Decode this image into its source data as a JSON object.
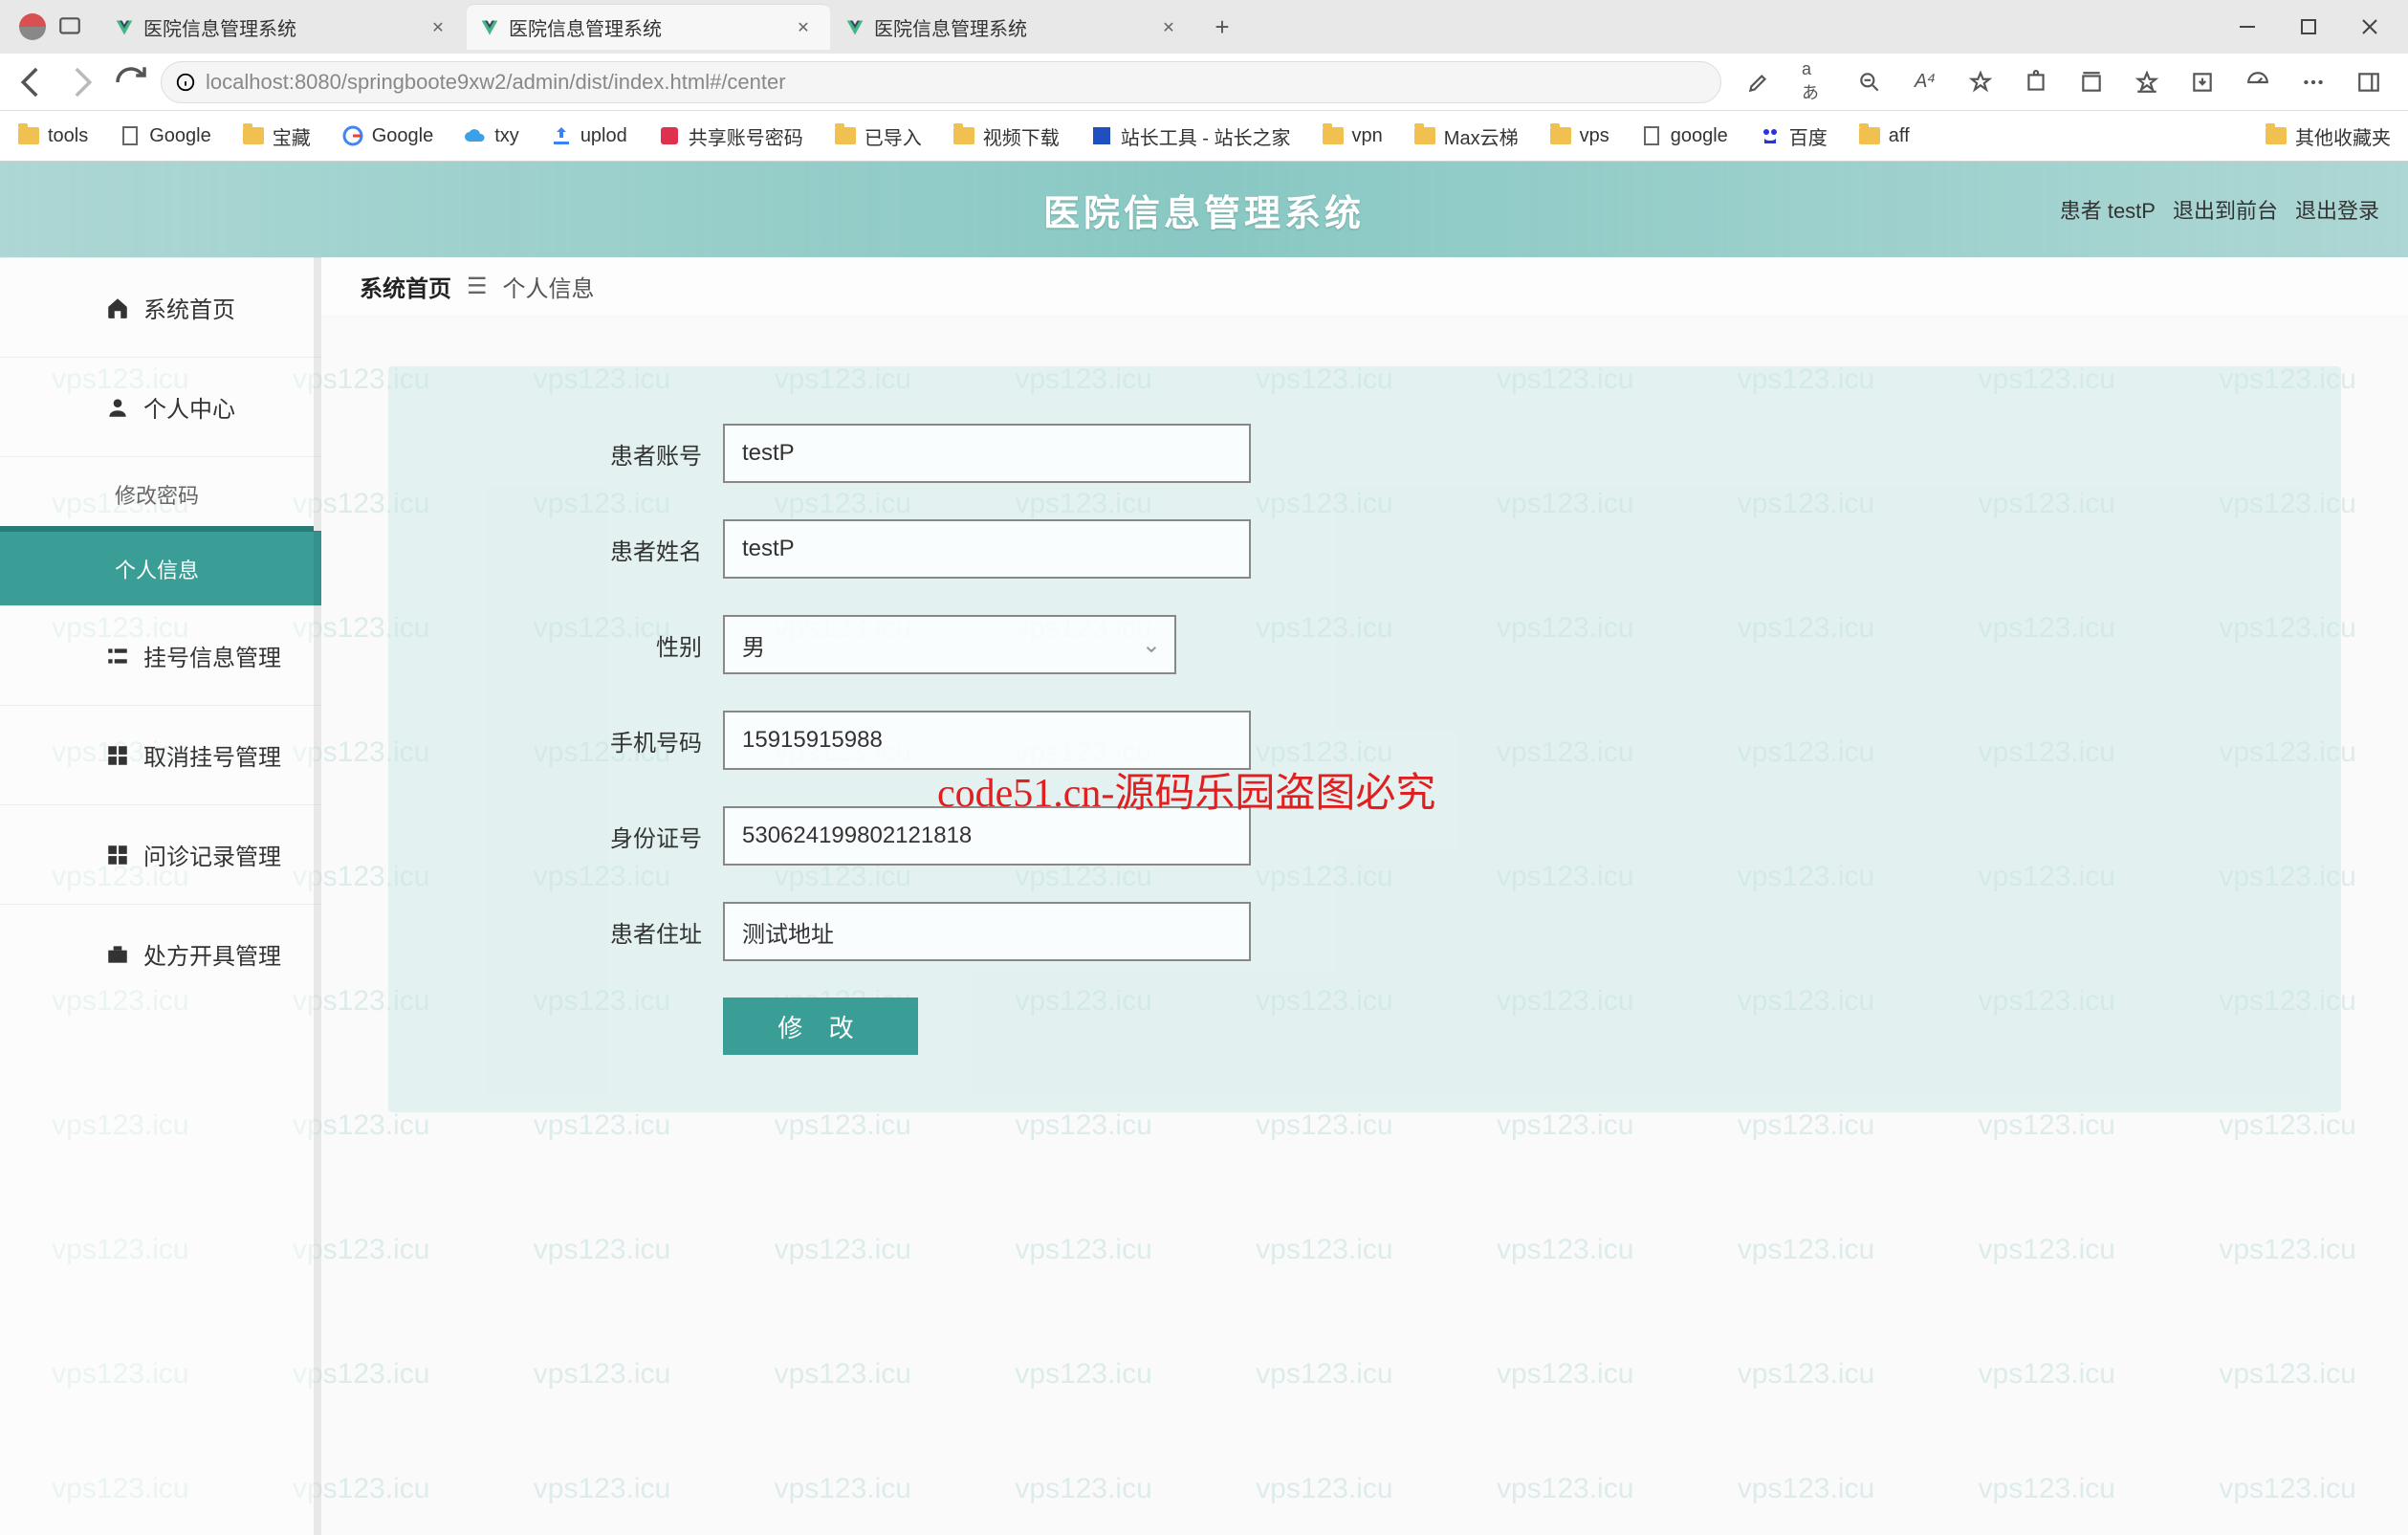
{
  "browser": {
    "tabs": [
      {
        "title": "医院信息管理系统",
        "active": false
      },
      {
        "title": "医院信息管理系统",
        "active": true
      },
      {
        "title": "医院信息管理系统",
        "active": false
      }
    ],
    "url": "localhost:8080/springboote9xw2/admin/dist/index.html#/center",
    "bookmarks": [
      {
        "label": "tools",
        "icon": "folder"
      },
      {
        "label": "Google",
        "icon": "page"
      },
      {
        "label": "宝藏",
        "icon": "folder"
      },
      {
        "label": "Google",
        "icon": "google"
      },
      {
        "label": "txy",
        "icon": "cloud"
      },
      {
        "label": "uplod",
        "icon": "upload"
      },
      {
        "label": "共享账号密码",
        "icon": "share"
      },
      {
        "label": "已导入",
        "icon": "folder"
      },
      {
        "label": "视频下载",
        "icon": "folder"
      },
      {
        "label": "站长工具 - 站长之家",
        "icon": "tool"
      },
      {
        "label": "vpn",
        "icon": "folder"
      },
      {
        "label": "Max云梯",
        "icon": "folder"
      },
      {
        "label": "vps",
        "icon": "folder"
      },
      {
        "label": "google",
        "icon": "page"
      },
      {
        "label": "百度",
        "icon": "baidu"
      },
      {
        "label": "aff",
        "icon": "folder"
      }
    ],
    "bookmarks_right": {
      "label": "其他收藏夹",
      "icon": "folder"
    }
  },
  "app": {
    "title": "医院信息管理系统",
    "header_right": {
      "user_role": "患者 testP",
      "to_front": "退出到前台",
      "logout": "退出登录"
    }
  },
  "sidebar": {
    "items": [
      {
        "label": "系统首页",
        "icon": "home",
        "active": false
      },
      {
        "label": "个人中心",
        "icon": "person",
        "active": false
      },
      {
        "label": "修改密码",
        "icon": "",
        "sub": true,
        "active": false
      },
      {
        "label": "个人信息",
        "icon": "",
        "sub": true,
        "active": true
      },
      {
        "label": "挂号信息管理",
        "icon": "list",
        "active": false
      },
      {
        "label": "取消挂号管理",
        "icon": "grid",
        "active": false
      },
      {
        "label": "问诊记录管理",
        "icon": "grid",
        "active": false
      },
      {
        "label": "处方开具管理",
        "icon": "briefcase",
        "active": false
      }
    ]
  },
  "breadcrumb": {
    "root": "系统首页",
    "separator": "☰",
    "current": "个人信息"
  },
  "form": {
    "fields": {
      "account": {
        "label": "患者账号",
        "value": "testP"
      },
      "name": {
        "label": "患者姓名",
        "value": "testP"
      },
      "gender": {
        "label": "性别",
        "value": "男"
      },
      "phone": {
        "label": "手机号码",
        "value": "15915915988"
      },
      "idcard": {
        "label": "身份证号",
        "value": "530624199802121818"
      },
      "address": {
        "label": "患者住址",
        "value": "测试地址"
      }
    },
    "submit_label": "修 改"
  },
  "watermark": {
    "repeat_text": "vps123.icu",
    "red_overlay": "code51.cn-源码乐园盗图必究"
  }
}
